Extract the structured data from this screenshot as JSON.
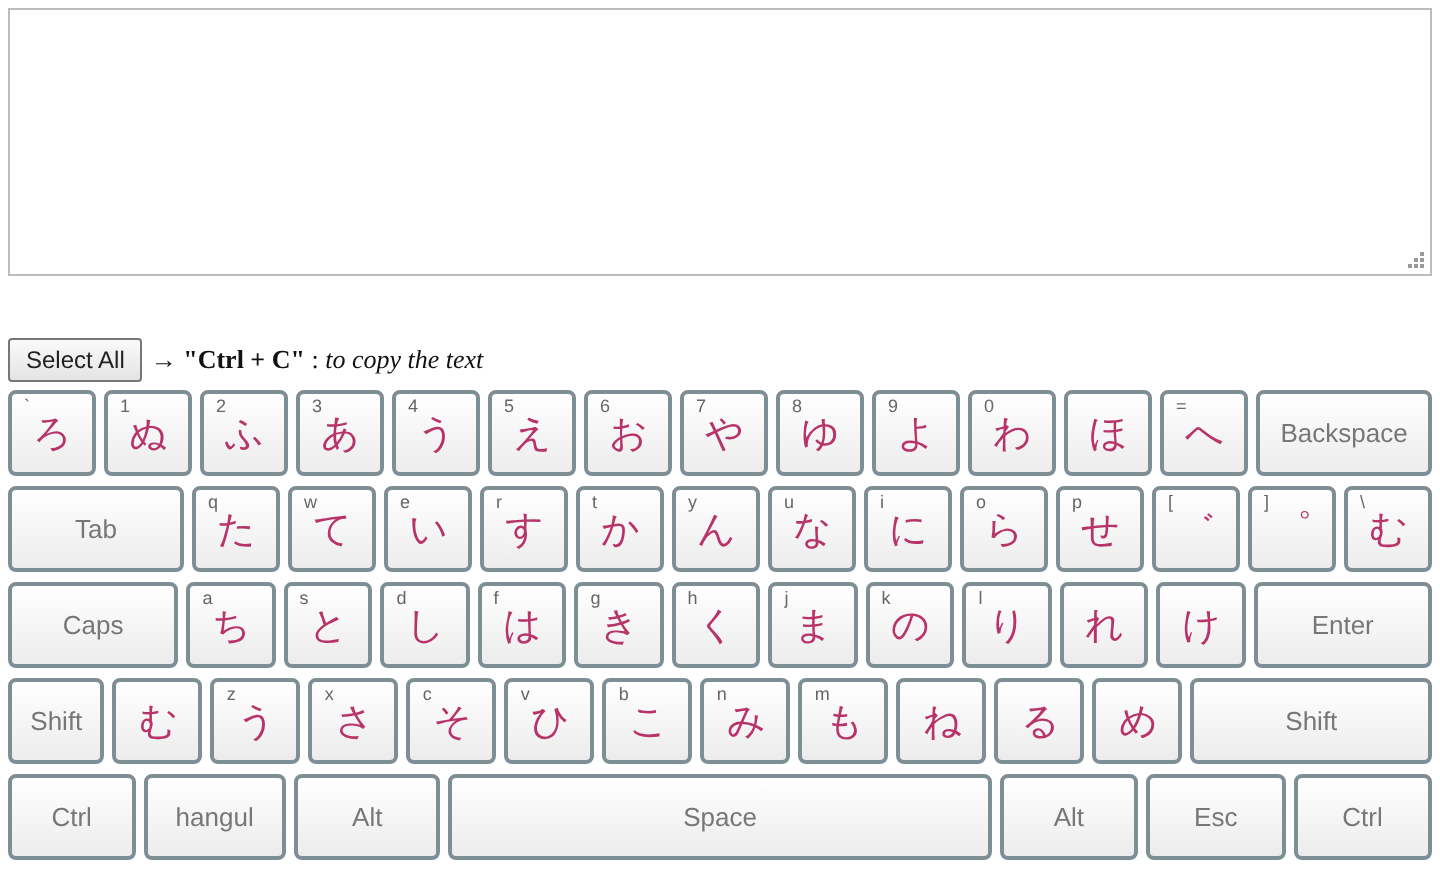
{
  "select_all": {
    "label": "Select All",
    "hint": "→ **\"Ctrl + C\"** : *to copy the text*"
  },
  "rows": [
    {
      "keys": [
        {
          "kind": "char",
          "main": "ろ",
          "sub": "`"
        },
        {
          "kind": "char",
          "main": "ぬ",
          "sub": "1"
        },
        {
          "kind": "char",
          "main": "ふ",
          "sub": "2"
        },
        {
          "kind": "char",
          "main": "あ",
          "sub": "3"
        },
        {
          "kind": "char",
          "main": "う",
          "sub": "4"
        },
        {
          "kind": "char",
          "main": "え",
          "sub": "5"
        },
        {
          "kind": "char",
          "main": "お",
          "sub": "6"
        },
        {
          "kind": "char",
          "main": "や",
          "sub": "7"
        },
        {
          "kind": "char",
          "main": "ゆ",
          "sub": "8"
        },
        {
          "kind": "char",
          "main": "よ",
          "sub": "9"
        },
        {
          "kind": "char",
          "main": "わ",
          "sub": "0"
        },
        {
          "kind": "char",
          "main": "ほ"
        },
        {
          "kind": "char",
          "main": "へ",
          "sub": "="
        },
        {
          "kind": "function",
          "main": "Backspace"
        }
      ]
    },
    {
      "keys": [
        {
          "kind": "function",
          "main": "Tab"
        },
        {
          "kind": "char",
          "main": "た",
          "sub": "q"
        },
        {
          "kind": "char",
          "main": "て",
          "sub": "w"
        },
        {
          "kind": "char",
          "main": "い",
          "sub": "e"
        },
        {
          "kind": "char",
          "main": "す",
          "sub": "r"
        },
        {
          "kind": "char",
          "main": "か",
          "sub": "t"
        },
        {
          "kind": "char",
          "main": "ん",
          "sub": "y"
        },
        {
          "kind": "char",
          "main": "な",
          "sub": "u"
        },
        {
          "kind": "char",
          "main": "に",
          "sub": "i"
        },
        {
          "kind": "char",
          "main": "ら",
          "sub": "o"
        },
        {
          "kind": "char",
          "main": "せ",
          "sub": "p"
        },
        {
          "kind": "char",
          "main": "゛",
          "sub": "["
        },
        {
          "kind": "char",
          "main": "゜",
          "sub": "]"
        },
        {
          "kind": "char",
          "main": "む",
          "sub": "\\"
        }
      ]
    },
    {
      "keys": [
        {
          "kind": "function",
          "main": "Caps"
        },
        {
          "kind": "char",
          "main": "ち",
          "sub": "a"
        },
        {
          "kind": "char",
          "main": "と",
          "sub": "s"
        },
        {
          "kind": "char",
          "main": "し",
          "sub": "d"
        },
        {
          "kind": "char",
          "main": "は",
          "sub": "f"
        },
        {
          "kind": "char",
          "main": "き",
          "sub": "g"
        },
        {
          "kind": "char",
          "main": "く",
          "sub": "h"
        },
        {
          "kind": "char",
          "main": "ま",
          "sub": "j"
        },
        {
          "kind": "char",
          "main": "の",
          "sub": "k"
        },
        {
          "kind": "char",
          "main": "り",
          "sub": "l"
        },
        {
          "kind": "char",
          "main": "れ"
        },
        {
          "kind": "char",
          "main": "け"
        },
        {
          "kind": "function",
          "main": "Enter"
        }
      ]
    },
    {
      "keys": [
        {
          "kind": "function",
          "main": "Shift"
        },
        {
          "kind": "char",
          "main": "む"
        },
        {
          "kind": "char",
          "main": "う",
          "sub": "z"
        },
        {
          "kind": "char",
          "main": "さ",
          "sub": "x"
        },
        {
          "kind": "char",
          "main": "そ",
          "sub": "c"
        },
        {
          "kind": "char",
          "main": "ひ",
          "sub": "v"
        },
        {
          "kind": "char",
          "main": "こ",
          "sub": "b"
        },
        {
          "kind": "char",
          "main": "み",
          "sub": "n"
        },
        {
          "kind": "char",
          "main": "も",
          "sub": "m"
        },
        {
          "kind": "char",
          "main": "ね"
        },
        {
          "kind": "char",
          "main": "る"
        },
        {
          "kind": "char",
          "main": "め"
        },
        {
          "kind": "function",
          "main": "Shift"
        }
      ]
    },
    {
      "keys": [
        {
          "kind": "function",
          "main": "Ctrl"
        },
        {
          "kind": "function",
          "main": "hangul"
        },
        {
          "kind": "function",
          "main": "Alt"
        },
        {
          "kind": "function",
          "main": "Space"
        },
        {
          "kind": "function",
          "main": "Alt"
        },
        {
          "kind": "function",
          "main": "Esc"
        },
        {
          "kind": "function",
          "main": "Ctrl"
        }
      ]
    }
  ]
}
